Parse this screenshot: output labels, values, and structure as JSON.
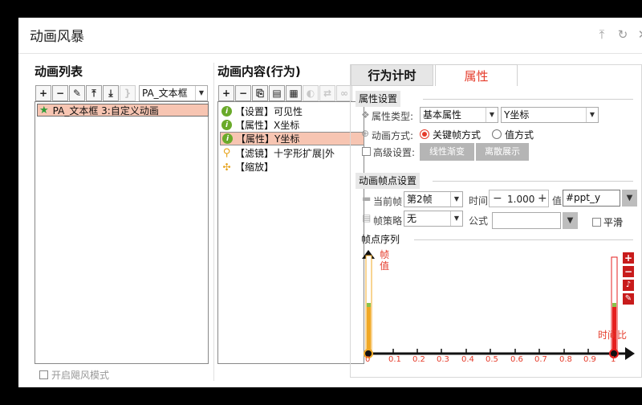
{
  "window": {
    "title": "动画风暴"
  },
  "left": {
    "title": "动画列表",
    "combo_value": "PA_文本框",
    "items": [
      {
        "label": "PA_文本框 3:自定义动画"
      }
    ],
    "checkbox_label": "开启飓风模式"
  },
  "middle": {
    "title": "动画内容(行为)",
    "items": [
      {
        "label": "【设置】可见性"
      },
      {
        "label": "【属性】X坐标"
      },
      {
        "label": "【属性】Y坐标"
      },
      {
        "label": "【滤镜】十字形扩展|外"
      },
      {
        "label": "【缩放】"
      }
    ]
  },
  "right": {
    "tabs": [
      {
        "label": "行为计时"
      },
      {
        "label": "属性"
      }
    ],
    "attr_section": "属性设置",
    "attr_type_label": "属性类型:",
    "attr_type_value": "基本属性",
    "attr_value": "Y坐标",
    "anim_mode_label": "动画方式:",
    "mode_keyframe": "关键帧方式",
    "mode_value": "值方式",
    "advanced_label": "高级设置:",
    "btn_linear": "线性渐变",
    "btn_discrete": "离散展示",
    "kf_section": "动画帧点设置",
    "cur_frame_label": "当前帧",
    "cur_frame_value": "第2帧",
    "time_label": "时间",
    "minus": "−",
    "time_value": "1.000",
    "plus": "+",
    "value_label": "值",
    "value_input": "#ppt_y",
    "strategy_label": "帧策略",
    "strategy_value": "无",
    "formula_label": "公式",
    "formula_value": "",
    "smooth_label": "平滑",
    "seq_section": "帧点序列",
    "y_axis_label": "帧\n值",
    "x_axis_label": "时间比",
    "ticks": [
      "0",
      "0.1",
      "0.2",
      "0.3",
      "0.4",
      "0.5",
      "0.6",
      "0.7",
      "0.8",
      "0.9",
      "1"
    ]
  },
  "colors": {
    "accent": "#e53b2a",
    "selection": "#f7c5b2",
    "orange_bar": "#f0a826",
    "red_bar": "#e51f1f"
  }
}
